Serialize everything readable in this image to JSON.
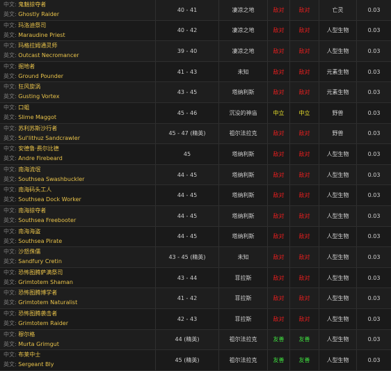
{
  "labels": {
    "zh": "中文:",
    "en": "英文:"
  },
  "colors": {
    "hostile": "#e61e1e",
    "neutral": "#e8e02a",
    "friendly": "#3fdc3f",
    "name": "#e8c24a"
  },
  "rows": [
    {
      "zh": "鬼魅掠夺者",
      "en": "Ghostly Raider",
      "level": "40 - 41",
      "zone": "凄凉之地",
      "ally": "敌对",
      "horde": "敌对",
      "react": "hostile",
      "type": "亡灵",
      "rate": "0.03"
    },
    {
      "zh": "玛洛迪祭司",
      "en": "Maraudine Priest",
      "level": "40 - 42",
      "zone": "凄凉之地",
      "ally": "敌对",
      "horde": "敌对",
      "react": "hostile",
      "type": "人型生物",
      "rate": "0.03"
    },
    {
      "zh": "玛格拉姆通灵师",
      "en": "Outcast Necromancer",
      "level": "39 - 40",
      "zone": "凄凉之地",
      "ally": "敌对",
      "horde": "敌对",
      "react": "hostile",
      "type": "人型生物",
      "rate": "0.03"
    },
    {
      "zh": "掘地者",
      "en": "Ground Pounder",
      "level": "41 - 43",
      "zone": "未知",
      "ally": "敌对",
      "horde": "敌对",
      "react": "hostile",
      "type": "元素生物",
      "rate": "0.03"
    },
    {
      "zh": "狂风旋涡",
      "en": "Gusting Vortex",
      "level": "43 - 45",
      "zone": "塔纳利斯",
      "ally": "敌对",
      "horde": "敌对",
      "react": "hostile",
      "type": "元素生物",
      "rate": "0.03"
    },
    {
      "zh": "口蛆",
      "en": "Slime Maggot",
      "level": "45 - 46",
      "zone": "沉没的神庙",
      "ally": "中立",
      "horde": "中立",
      "react": "neutral",
      "type": "野兽",
      "rate": "0.03"
    },
    {
      "zh": "苏利苏斯沙行者",
      "en": "Sul'lithuz Sandcrawler",
      "level": "45 - 47 (精英)",
      "zone": "祖尔法拉克",
      "ally": "敌对",
      "horde": "敌对",
      "react": "hostile",
      "type": "野兽",
      "rate": "0.03"
    },
    {
      "zh": "安德鲁·费尔比德",
      "en": "Andre Firebeard",
      "level": "45",
      "zone": "塔纳利斯",
      "ally": "敌对",
      "horde": "敌对",
      "react": "hostile",
      "type": "人型生物",
      "rate": "0.03"
    },
    {
      "zh": "南海流氓",
      "en": "Southsea Swashbuckler",
      "level": "44 - 45",
      "zone": "塔纳利斯",
      "ally": "敌对",
      "horde": "敌对",
      "react": "hostile",
      "type": "人型生物",
      "rate": "0.03"
    },
    {
      "zh": "南海码头工人",
      "en": "Southsea Dock Worker",
      "level": "44 - 45",
      "zone": "塔纳利斯",
      "ally": "敌对",
      "horde": "敌对",
      "react": "hostile",
      "type": "人型生物",
      "rate": "0.03"
    },
    {
      "zh": "南海掠夺者",
      "en": "Southsea Freebooter",
      "level": "44 - 45",
      "zone": "塔纳利斯",
      "ally": "敌对",
      "horde": "敌对",
      "react": "hostile",
      "type": "人型生物",
      "rate": "0.03"
    },
    {
      "zh": "南海海盗",
      "en": "Southsea Pirate",
      "level": "44 - 45",
      "zone": "塔纳利斯",
      "ally": "敌对",
      "horde": "敌对",
      "react": "hostile",
      "type": "人型生物",
      "rate": "0.03"
    },
    {
      "zh": "沙怒侏儒",
      "en": "Sandfury Cretin",
      "level": "43 - 45 (精英)",
      "zone": "未知",
      "ally": "敌对",
      "horde": "敌对",
      "react": "hostile",
      "type": "人型生物",
      "rate": "0.03"
    },
    {
      "zh": "恐怖图腾萨满祭司",
      "en": "Grimtotem Shaman",
      "level": "43 - 44",
      "zone": "菲拉斯",
      "ally": "敌对",
      "horde": "敌对",
      "react": "hostile",
      "type": "人型生物",
      "rate": "0.03"
    },
    {
      "zh": "恐怖图腾博学者",
      "en": "Grimtotem Naturalist",
      "level": "41 - 42",
      "zone": "菲拉斯",
      "ally": "敌对",
      "horde": "敌对",
      "react": "hostile",
      "type": "人型生物",
      "rate": "0.03"
    },
    {
      "zh": "恐怖图腾袭击者",
      "en": "Grimtotem Raider",
      "level": "42 - 43",
      "zone": "菲拉斯",
      "ally": "敌对",
      "horde": "敌对",
      "react": "hostile",
      "type": "人型生物",
      "rate": "0.03"
    },
    {
      "zh": "穆尔格",
      "en": "Murta Grimgut",
      "level": "44 (精英)",
      "zone": "祖尔法拉克",
      "ally": "友善",
      "horde": "友善",
      "react": "friendly",
      "type": "人型生物",
      "rate": "0.03"
    },
    {
      "zh": "布莱中士",
      "en": "Sergeant Bly",
      "level": "45 (精英)",
      "zone": "祖尔法拉克",
      "ally": "友善",
      "horde": "友善",
      "react": "friendly",
      "type": "人型生物",
      "rate": "0.03"
    }
  ]
}
